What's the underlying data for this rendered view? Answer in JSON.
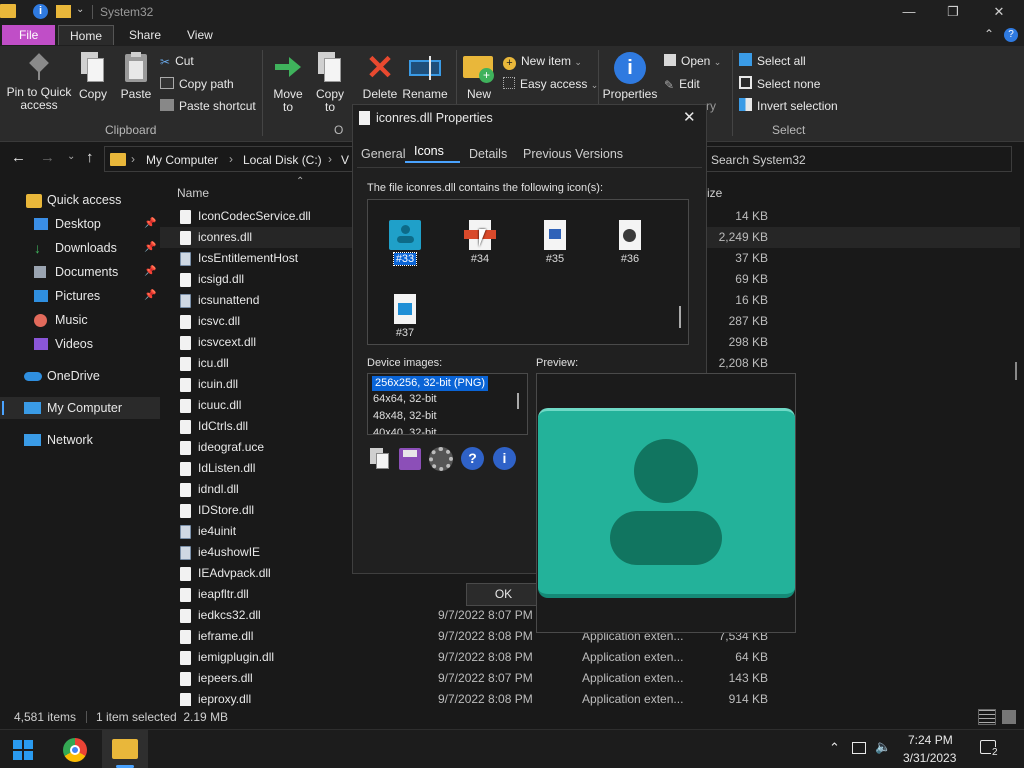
{
  "window": {
    "title": "System32",
    "minimize": "—",
    "maximize": "❐",
    "close": "✕"
  },
  "ribbon": {
    "tabs": [
      "File",
      "Home",
      "Share",
      "View"
    ],
    "pin_to_quick_access": "Pin to Quick access",
    "copy": "Copy",
    "paste": "Paste",
    "cut": "Cut",
    "copy_path": "Copy path",
    "paste_shortcut": "Paste shortcut",
    "clipboard_group": "Clipboard",
    "move_to": "Move to",
    "copy_to": "Copy to",
    "delete": "Delete",
    "rename": "Rename",
    "organize_group_partial": "O",
    "new_folder": "New",
    "new_item": "New item",
    "easy_access": "Easy access",
    "properties": "Properties",
    "open": "Open",
    "edit": "Edit",
    "history_partial": "ry",
    "select_all": "Select all",
    "select_none": "Select none",
    "invert_selection": "Invert selection",
    "select_group": "Select"
  },
  "address": {
    "crumbs": [
      "My Computer",
      "Local Disk (C:)",
      "V"
    ],
    "search_placeholder": "Search System32"
  },
  "navpane": {
    "items": [
      {
        "label": "Quick access",
        "icon": "star-icon",
        "color": "#3b8eea"
      },
      {
        "label": "Desktop",
        "icon": "desktop-icon",
        "color": "#3a8ee6"
      },
      {
        "label": "Downloads",
        "icon": "download-icon",
        "color": "#3fb25c"
      },
      {
        "label": "Documents",
        "icon": "document-icon",
        "color": "#9aa4b1"
      },
      {
        "label": "Pictures",
        "icon": "picture-icon",
        "color": "#2f8fe0"
      },
      {
        "label": "Music",
        "icon": "music-icon",
        "color": "#e26a5b"
      },
      {
        "label": "Videos",
        "icon": "video-icon",
        "color": "#8a56d8"
      },
      {
        "label": "OneDrive",
        "icon": "cloud-icon",
        "color": "#2f8fe0"
      },
      {
        "label": "My Computer",
        "icon": "computer-icon",
        "color": "#3a9be6"
      },
      {
        "label": "Network",
        "icon": "network-icon",
        "color": "#3a9be6"
      }
    ]
  },
  "filelist": {
    "col_name": "Name",
    "col_size_partial": "ize",
    "rows": [
      {
        "name": "IconCodecService.dll",
        "date": "",
        "type": "",
        "size": "14 KB"
      },
      {
        "name": "iconres.dll",
        "date": "",
        "type": "",
        "size": "2,249 KB"
      },
      {
        "name": "IcsEntitlementHost",
        "date": "",
        "type": "",
        "size": "37 KB"
      },
      {
        "name": "icsigd.dll",
        "date": "",
        "type": "",
        "size": "69 KB"
      },
      {
        "name": "icsunattend",
        "date": "",
        "type": "",
        "size": "16 KB"
      },
      {
        "name": "icsvc.dll",
        "date": "",
        "type": "",
        "size": "287 KB"
      },
      {
        "name": "icsvcext.dll",
        "date": "",
        "type": "",
        "size": "298 KB"
      },
      {
        "name": "icu.dll",
        "date": "",
        "type": "",
        "size": "2,208 KB"
      },
      {
        "name": "icuin.dll",
        "date": "",
        "type": "",
        "size": ""
      },
      {
        "name": "icuuc.dll",
        "date": "",
        "type": "",
        "size": ""
      },
      {
        "name": "IdCtrls.dll",
        "date": "",
        "type": "",
        "size": ""
      },
      {
        "name": "ideograf.uce",
        "date": "",
        "type": "",
        "size": ""
      },
      {
        "name": "IdListen.dll",
        "date": "",
        "type": "",
        "size": ""
      },
      {
        "name": "idndl.dll",
        "date": "",
        "type": "",
        "size": ""
      },
      {
        "name": "IDStore.dll",
        "date": "",
        "type": "",
        "size": ""
      },
      {
        "name": "ie4uinit",
        "date": "",
        "type": "",
        "size": ""
      },
      {
        "name": "ie4ushowIE",
        "date": "",
        "type": "",
        "size": ""
      },
      {
        "name": "IEAdvpack.dll",
        "date": "",
        "type": "",
        "size": ""
      },
      {
        "name": "ieapfltr.dll",
        "date": "",
        "type": "",
        "size": ""
      },
      {
        "name": "iedkcs32.dll",
        "date": "9/7/2022 8:07 PM",
        "type": "",
        "size": ""
      },
      {
        "name": "ieframe.dll",
        "date": "9/7/2022 8:08 PM",
        "type": "Application exten...",
        "size": "7,534 KB"
      },
      {
        "name": "iemigplugin.dll",
        "date": "9/7/2022 8:08 PM",
        "type": "Application exten...",
        "size": "64 KB"
      },
      {
        "name": "iepeers.dll",
        "date": "9/7/2022 8:07 PM",
        "type": "Application exten...",
        "size": "143 KB"
      },
      {
        "name": "ieproxy.dll",
        "date": "9/7/2022 8:08 PM",
        "type": "Application exten...",
        "size": "914 KB"
      }
    ]
  },
  "status": {
    "count": "4,581 items",
    "selected": "1 item selected  2.19 MB"
  },
  "dialog": {
    "title": "iconres.dll Properties",
    "close": "✕",
    "tabs": [
      "General",
      "Icons",
      "Details",
      "Previous Versions"
    ],
    "contains_label": "The file iconres.dll contains the following icon(s):",
    "icons": [
      "#33",
      "#34",
      "#35",
      "#36",
      "#37"
    ],
    "device_images_label": "Device images:",
    "device_images": [
      "256x256, 32-bit (PNG)",
      "64x64, 32-bit",
      "48x48, 32-bit",
      "40x40, 32-bit"
    ],
    "preview_label": "Preview:",
    "ok": "OK"
  },
  "taskbar": {
    "time": "7:24 PM",
    "date": "3/31/2023",
    "notifications": "2"
  },
  "colors": {
    "accent_file_tab": "#c04ec7",
    "preview_teal": "#23b29a",
    "selection_blue": "#0a64d6"
  }
}
